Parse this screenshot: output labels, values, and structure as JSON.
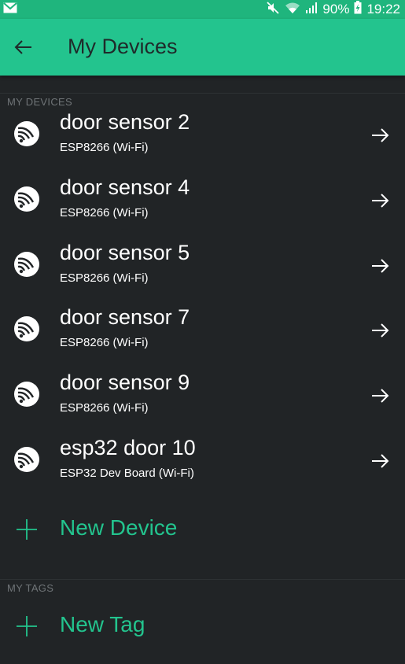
{
  "status_bar": {
    "battery": "90%",
    "time": "19:22"
  },
  "app_bar": {
    "title": "My Devices",
    "back_icon": "arrow-left-icon",
    "accent": "#23c48e"
  },
  "sections": {
    "devices_header": "MY DEVICES",
    "tags_header": "MY TAGS"
  },
  "devices": [
    {
      "name": "door sensor 2",
      "type": "ESP8266 (Wi-Fi)",
      "icon": "espressif-chip-icon"
    },
    {
      "name": "door sensor 4",
      "type": "ESP8266 (Wi-Fi)",
      "icon": "espressif-chip-icon"
    },
    {
      "name": "door sensor 5",
      "type": "ESP8266 (Wi-Fi)",
      "icon": "espressif-chip-icon"
    },
    {
      "name": "door sensor 7",
      "type": "ESP8266 (Wi-Fi)",
      "icon": "espressif-chip-icon"
    },
    {
      "name": "door sensor 9",
      "type": "ESP8266 (Wi-Fi)",
      "icon": "espressif-chip-icon"
    },
    {
      "name": "esp32 door 10",
      "type": "ESP32 Dev Board (Wi-Fi)",
      "icon": "espressif-chip-icon"
    }
  ],
  "actions": {
    "new_device": "New Device",
    "new_tag": "New Tag"
  }
}
